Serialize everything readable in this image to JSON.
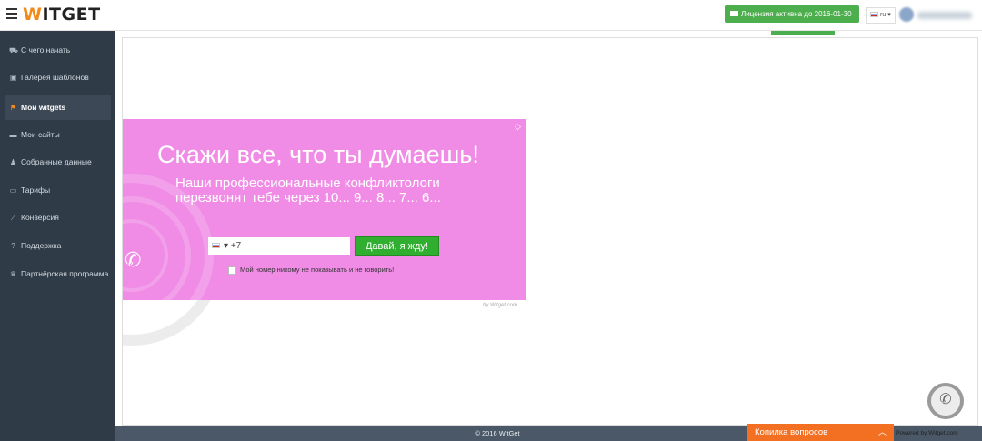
{
  "header": {
    "logo_prefix": "W",
    "logo_rest": "ITGET",
    "license_label": "Лицензия активна до 2016-01-30",
    "language": "ru",
    "colors": {
      "license_green": "#4cae4c",
      "logo_orange": "#f28a1a"
    }
  },
  "sidebar": {
    "items": [
      {
        "icon": "car-icon",
        "glyph": "⛟",
        "label": "С чего начать"
      },
      {
        "icon": "image-icon",
        "glyph": "▣",
        "label": "Галерея шаблонов"
      },
      {
        "icon": "flag-icon",
        "glyph": "⚑",
        "label": "Мои witgets"
      },
      {
        "icon": "folder-icon",
        "glyph": "▬",
        "label": "Мои сайты"
      },
      {
        "icon": "user-icon",
        "glyph": "♟",
        "label": "Собранные данные"
      },
      {
        "icon": "money-icon",
        "glyph": "▭",
        "label": "Тарифы"
      },
      {
        "icon": "chart-icon",
        "glyph": "⟋",
        "label": "Конверсия"
      },
      {
        "icon": "question-icon",
        "glyph": "?",
        "label": "Поддержка"
      },
      {
        "icon": "trophy-icon",
        "glyph": "♛",
        "label": "Партнёрская программа"
      }
    ],
    "active_index": 2
  },
  "widget": {
    "title": "Скажи все, что ты думаешь!",
    "subtitle": "Наши профессиональные конфликтологи перезвонят тебе через 10... 9... 8... 7... 6...",
    "phone_value": "+7",
    "submit_label": "Давай, я жду!",
    "privacy_label": "Мой номер никому не показывать и не говорить!",
    "branding": "by Witget.com",
    "colors": {
      "background": "#f08ce6",
      "button": "#2fae2f"
    }
  },
  "footer": {
    "copyright": "© 2016 WitGet",
    "kopilka_label": "Копилка вопросов",
    "powered": "Powered by Witget.com"
  }
}
